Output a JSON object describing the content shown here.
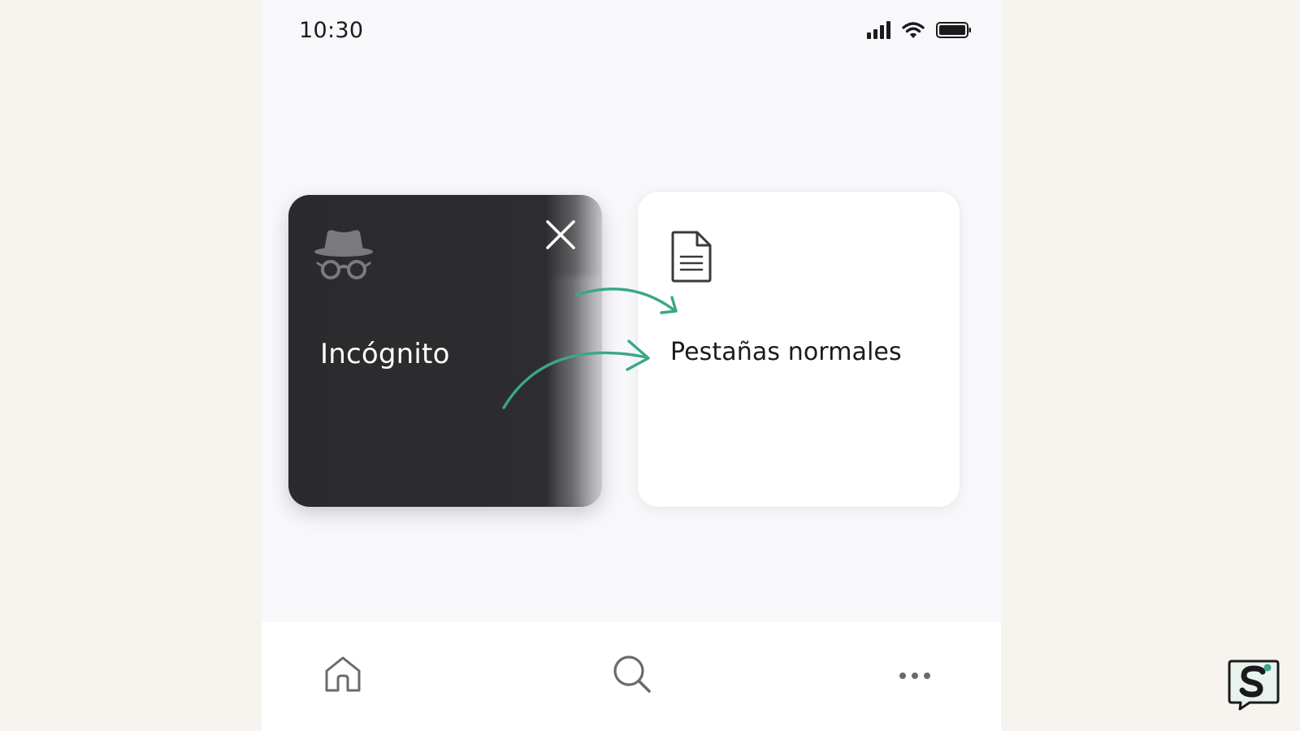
{
  "status_bar": {
    "time": "10:30",
    "icons": [
      "signal-icon",
      "wifi-icon",
      "battery-icon"
    ]
  },
  "tabs": {
    "incognito": {
      "label": "Incógnito",
      "icon": "incognito-icon",
      "close_icon": "close-icon",
      "background": "#2d2d30"
    },
    "normal": {
      "label": "Pestañas normales",
      "icon": "document-icon",
      "background": "#ffffff"
    },
    "arrow_color": "#3aa886"
  },
  "bottom_nav": {
    "items": [
      {
        "icon": "home-icon"
      },
      {
        "icon": "search-icon"
      },
      {
        "icon": "more-icon"
      }
    ]
  },
  "watermark": {
    "letter": "S",
    "accent": "#3aa886"
  }
}
